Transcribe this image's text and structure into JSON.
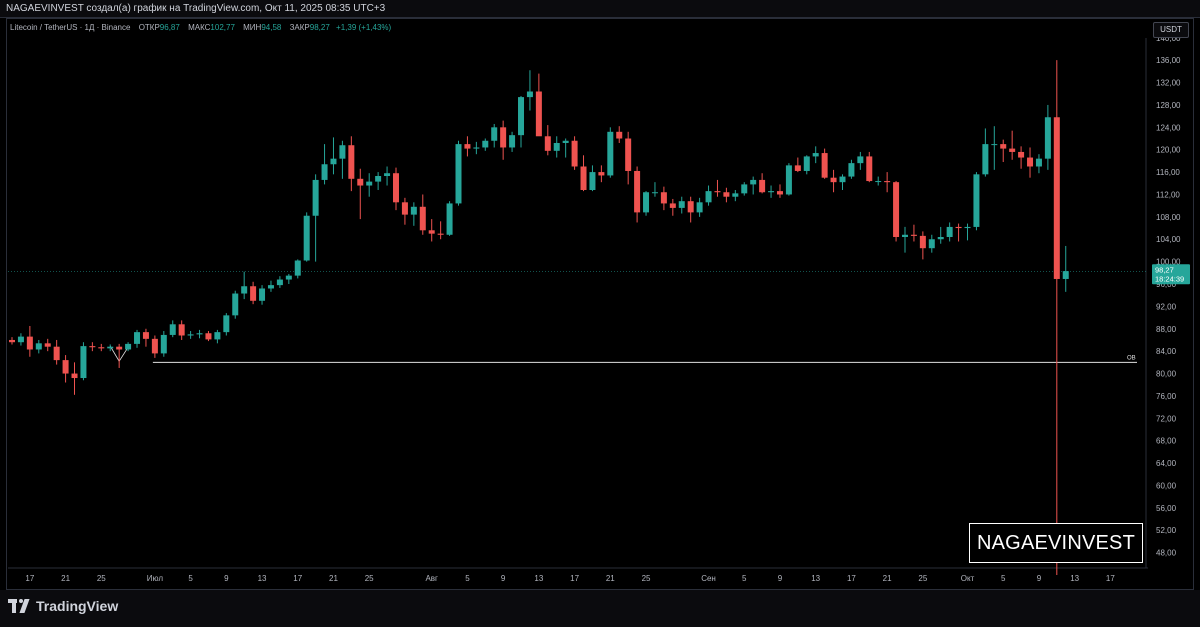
{
  "header": {
    "text": "NAGAEVINVEST создал(а) график на TradingView.com, Окт 11, 2025 08:35 UTC+3"
  },
  "legend": {
    "symbol": "Litecoin / TetherUS · 1Д · Binance",
    "open_label": "ОТКР",
    "open_value": "96,87",
    "high_label": "МАКС",
    "high_value": "102,77",
    "low_label": "МИН",
    "low_value": "94,58",
    "close_label": "ЗАКР",
    "close_value": "98,27",
    "change": "+1,39 (+1,43%)"
  },
  "currency_button": "USDT",
  "price_label": {
    "price": "98,27",
    "countdown": "18:24:39"
  },
  "level_label": "OB",
  "brand_text": "NAGAEVINVEST",
  "footer_logo": "TradingView",
  "colors": {
    "up": "#26a69a",
    "down": "#ef5350",
    "background": "#000000",
    "text": "#b2b5be"
  },
  "chart_data": {
    "type": "candlestick",
    "y_ticks": [
      "48,00",
      "52,00",
      "56,00",
      "60,00",
      "64,00",
      "68,00",
      "72,00",
      "76,00",
      "80,00",
      "84,00",
      "88,00",
      "92,00",
      "96,00",
      "100,00",
      "104,00",
      "108,00",
      "112,00",
      "116,00",
      "120,00",
      "124,00",
      "128,00",
      "132,00",
      "136,00",
      "140,00"
    ],
    "y_tick_values": [
      48,
      52,
      56,
      60,
      64,
      68,
      72,
      76,
      80,
      84,
      88,
      92,
      96,
      100,
      104,
      108,
      112,
      116,
      120,
      124,
      128,
      132,
      136,
      140
    ],
    "ylim": [
      44,
      143
    ],
    "x_ticks": [
      {
        "label": "17",
        "i": 2
      },
      {
        "label": "21",
        "i": 6
      },
      {
        "label": "25",
        "i": 10
      },
      {
        "label": "Июл",
        "i": 16
      },
      {
        "label": "5",
        "i": 20
      },
      {
        "label": "9",
        "i": 24
      },
      {
        "label": "13",
        "i": 28
      },
      {
        "label": "17",
        "i": 32
      },
      {
        "label": "21",
        "i": 36
      },
      {
        "label": "25",
        "i": 40
      },
      {
        "label": "Авг",
        "i": 47
      },
      {
        "label": "5",
        "i": 51
      },
      {
        "label": "9",
        "i": 55
      },
      {
        "label": "13",
        "i": 59
      },
      {
        "label": "17",
        "i": 63
      },
      {
        "label": "21",
        "i": 67
      },
      {
        "label": "25",
        "i": 71
      },
      {
        "label": "Сен",
        "i": 78
      },
      {
        "label": "5",
        "i": 82
      },
      {
        "label": "9",
        "i": 86
      },
      {
        "label": "13",
        "i": 90
      },
      {
        "label": "17",
        "i": 94
      },
      {
        "label": "21",
        "i": 98
      },
      {
        "label": "25",
        "i": 102
      },
      {
        "label": "Окт",
        "i": 107
      },
      {
        "label": "5",
        "i": 111
      },
      {
        "label": "9",
        "i": 115
      },
      {
        "label": "13",
        "i": 119
      },
      {
        "label": "17",
        "i": 123
      }
    ],
    "last_price": 98.27,
    "horizontal_level": 82.0,
    "candles": [
      [
        86.0,
        86.5,
        85.2,
        85.6
      ],
      [
        85.6,
        87.2,
        85.0,
        86.6
      ],
      [
        86.6,
        88.5,
        83.0,
        84.3
      ],
      [
        84.3,
        86.0,
        83.6,
        85.4
      ],
      [
        85.4,
        86.2,
        84.0,
        84.8
      ],
      [
        84.8,
        86.0,
        81.6,
        82.4
      ],
      [
        82.4,
        83.3,
        78.4,
        80.0
      ],
      [
        80.0,
        82.0,
        76.2,
        79.2
      ],
      [
        79.2,
        85.6,
        78.8,
        84.9
      ],
      [
        84.9,
        85.6,
        84.0,
        84.7
      ],
      [
        84.7,
        85.3,
        84.0,
        84.5
      ],
      [
        84.5,
        85.2,
        84.0,
        84.8
      ],
      [
        84.8,
        85.3,
        81.0,
        84.3
      ],
      [
        84.3,
        85.6,
        84.0,
        85.3
      ],
      [
        85.3,
        87.8,
        84.6,
        87.4
      ],
      [
        87.4,
        88.0,
        84.8,
        86.2
      ],
      [
        86.2,
        86.8,
        82.8,
        83.6
      ],
      [
        83.6,
        87.6,
        83.0,
        86.9
      ],
      [
        86.9,
        89.5,
        86.5,
        88.8
      ],
      [
        88.8,
        89.5,
        86.0,
        86.8
      ],
      [
        86.8,
        87.6,
        86.2,
        87.0
      ],
      [
        87.0,
        87.8,
        86.3,
        87.2
      ],
      [
        87.2,
        87.6,
        85.8,
        86.1
      ],
      [
        86.1,
        87.8,
        85.4,
        87.4
      ],
      [
        87.4,
        90.8,
        86.8,
        90.4
      ],
      [
        90.4,
        94.8,
        89.8,
        94.3
      ],
      [
        94.3,
        98.2,
        93.3,
        95.6
      ],
      [
        95.6,
        96.4,
        92.4,
        93.0
      ],
      [
        93.0,
        95.8,
        92.3,
        95.2
      ],
      [
        95.2,
        96.6,
        94.6,
        95.8
      ],
      [
        95.8,
        97.4,
        95.3,
        96.8
      ],
      [
        96.8,
        97.8,
        96.0,
        97.5
      ],
      [
        97.5,
        100.4,
        97.0,
        100.2
      ],
      [
        100.2,
        108.8,
        100.0,
        108.2
      ],
      [
        108.2,
        115.6,
        100.0,
        114.6
      ],
      [
        114.6,
        121.0,
        113.8,
        117.4
      ],
      [
        117.4,
        122.2,
        115.6,
        118.4
      ],
      [
        118.4,
        121.6,
        114.8,
        120.8
      ],
      [
        120.8,
        122.4,
        112.6,
        114.8
      ],
      [
        114.8,
        116.6,
        107.6,
        113.6
      ],
      [
        113.6,
        115.8,
        111.6,
        114.3
      ],
      [
        114.3,
        116.0,
        112.8,
        115.3
      ],
      [
        115.3,
        117.0,
        113.6,
        115.8
      ],
      [
        115.8,
        116.8,
        109.2,
        110.6
      ],
      [
        110.6,
        111.4,
        106.6,
        108.4
      ],
      [
        108.4,
        110.6,
        106.4,
        109.8
      ],
      [
        109.8,
        112.0,
        104.8,
        105.6
      ],
      [
        105.6,
        107.6,
        103.6,
        105.0
      ],
      [
        105.0,
        107.2,
        104.0,
        104.8
      ],
      [
        104.8,
        110.8,
        104.6,
        110.4
      ],
      [
        110.4,
        121.6,
        110.0,
        121.0
      ],
      [
        121.0,
        122.4,
        118.8,
        120.2
      ],
      [
        120.2,
        121.4,
        119.2,
        120.4
      ],
      [
        120.4,
        122.0,
        119.8,
        121.6
      ],
      [
        121.6,
        124.6,
        120.4,
        124.0
      ],
      [
        124.0,
        125.2,
        118.2,
        120.4
      ],
      [
        120.4,
        123.2,
        119.6,
        122.6
      ],
      [
        122.6,
        129.6,
        120.4,
        129.4
      ],
      [
        129.4,
        134.2,
        127.0,
        130.4
      ],
      [
        130.4,
        133.6,
        122.6,
        122.4
      ],
      [
        122.4,
        124.4,
        119.0,
        119.8
      ],
      [
        119.8,
        122.4,
        118.6,
        121.2
      ],
      [
        121.2,
        122.0,
        118.6,
        121.6
      ],
      [
        121.6,
        122.4,
        116.4,
        117.0
      ],
      [
        117.0,
        119.0,
        112.6,
        112.8
      ],
      [
        112.8,
        117.2,
        112.6,
        116.0
      ],
      [
        116.0,
        117.2,
        114.2,
        115.4
      ],
      [
        115.4,
        124.0,
        115.0,
        123.2
      ],
      [
        123.2,
        124.2,
        121.2,
        122.0
      ],
      [
        122.0,
        123.2,
        113.8,
        116.2
      ],
      [
        116.2,
        117.0,
        107.0,
        108.8
      ],
      [
        108.8,
        112.6,
        108.2,
        112.4
      ],
      [
        112.4,
        114.2,
        111.6,
        112.4
      ],
      [
        112.4,
        113.4,
        109.2,
        110.4
      ],
      [
        110.4,
        111.2,
        108.2,
        109.6
      ],
      [
        109.6,
        111.6,
        108.6,
        110.8
      ],
      [
        110.8,
        111.6,
        107.0,
        108.8
      ],
      [
        108.8,
        111.4,
        108.0,
        110.6
      ],
      [
        110.6,
        113.6,
        110.0,
        112.6
      ],
      [
        112.6,
        114.6,
        111.6,
        112.4
      ],
      [
        112.4,
        113.2,
        110.6,
        111.6
      ],
      [
        111.6,
        112.8,
        110.8,
        112.2
      ],
      [
        112.2,
        114.2,
        111.8,
        113.8
      ],
      [
        113.8,
        115.2,
        112.0,
        114.6
      ],
      [
        114.6,
        115.8,
        112.2,
        112.4
      ],
      [
        112.4,
        113.6,
        111.4,
        112.6
      ],
      [
        112.6,
        113.8,
        111.4,
        112.0
      ],
      [
        112.0,
        117.6,
        111.8,
        117.2
      ],
      [
        117.2,
        118.6,
        116.0,
        116.2
      ],
      [
        116.2,
        119.0,
        115.6,
        118.8
      ],
      [
        118.8,
        120.6,
        117.6,
        119.4
      ],
      [
        119.4,
        120.2,
        114.8,
        115.0
      ],
      [
        115.0,
        116.4,
        112.4,
        114.2
      ],
      [
        114.2,
        115.6,
        112.8,
        115.2
      ],
      [
        115.2,
        118.2,
        114.8,
        117.6
      ],
      [
        117.6,
        119.6,
        116.4,
        118.8
      ],
      [
        118.8,
        119.6,
        114.2,
        114.4
      ],
      [
        114.4,
        115.2,
        113.6,
        114.4
      ],
      [
        114.4,
        116.0,
        112.4,
        114.2
      ],
      [
        114.2,
        114.4,
        103.6,
        104.4
      ],
      [
        104.4,
        106.2,
        101.6,
        104.8
      ],
      [
        104.8,
        106.6,
        103.6,
        104.6
      ],
      [
        104.6,
        105.4,
        100.4,
        102.4
      ],
      [
        102.4,
        104.8,
        101.6,
        104.0
      ],
      [
        104.0,
        106.2,
        103.2,
        104.4
      ],
      [
        104.4,
        107.0,
        103.6,
        106.2
      ],
      [
        106.2,
        106.8,
        103.6,
        106.0
      ],
      [
        106.0,
        106.8,
        103.8,
        106.2
      ],
      [
        106.2,
        116.0,
        105.6,
        115.6
      ],
      [
        115.6,
        123.8,
        115.2,
        121.0
      ],
      [
        121.0,
        124.2,
        116.4,
        121.0
      ],
      [
        121.0,
        121.8,
        117.8,
        120.2
      ],
      [
        120.2,
        123.4,
        118.2,
        119.6
      ],
      [
        119.6,
        120.6,
        116.6,
        118.6
      ],
      [
        118.6,
        120.4,
        115.0,
        117.0
      ],
      [
        117.0,
        119.2,
        115.8,
        118.4
      ],
      [
        118.4,
        128.0,
        116.4,
        125.8
      ],
      [
        125.8,
        136.0,
        44.0,
        96.9
      ],
      [
        96.9,
        102.8,
        94.6,
        98.3
      ]
    ]
  }
}
